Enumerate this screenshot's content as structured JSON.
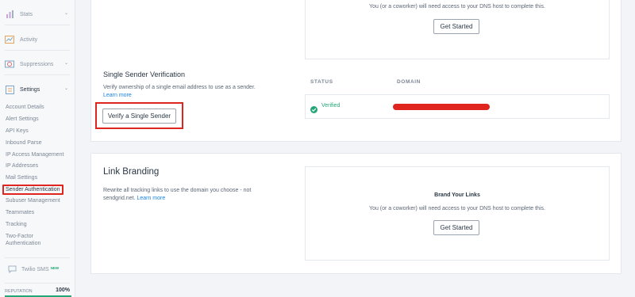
{
  "sidebar": {
    "top_items": [
      {
        "label": "Stats",
        "icon": "bar-chart-icon",
        "chevron": true
      },
      {
        "label": "Activity",
        "icon": "activity-icon",
        "chevron": false
      },
      {
        "label": "Suppressions",
        "icon": "suppressions-icon",
        "chevron": true
      },
      {
        "label": "Settings",
        "icon": "gear-icon",
        "chevron": true
      }
    ],
    "settings_items": [
      "Account Details",
      "Alert Settings",
      "API Keys",
      "Inbound Parse",
      "IP Access Management",
      "IP Addresses",
      "Mail Settings",
      "Sender Authentication",
      "Subuser Management",
      "Teammates",
      "Tracking",
      "Two-Factor",
      "Authentication"
    ],
    "twilio": {
      "label": "Twilio SMS",
      "badge": "NEW"
    },
    "reputation": {
      "label": "REPUTATION",
      "value": "100%",
      "fraction": 1.0
    }
  },
  "domain_section": {
    "dns_text": "You (or a coworker) will need access to your DNS host to complete this.",
    "button": "Get Started"
  },
  "single_sender": {
    "title": "Single Sender Verification",
    "description": "Verify ownership of a single email address to use as a sender.",
    "link": "Learn more",
    "button": "Verify a Single Sender",
    "table": {
      "headers": [
        "STATUS",
        "DOMAIN"
      ],
      "row": {
        "status": "Verified",
        "status_color": "#23a776"
      }
    }
  },
  "link_branding": {
    "title": "Link Branding",
    "description": "Rewrite all tracking links to use the domain you choose - not sendgrid.net.",
    "link": "Learn more",
    "box_title": "Brand Your Links",
    "dns_text": "You (or a coworker) will need access to your DNS host to complete this.",
    "button": "Get Started"
  },
  "colors": {
    "accent": "#1a82e2",
    "success": "#23a776",
    "highlight": "#e0251f"
  }
}
